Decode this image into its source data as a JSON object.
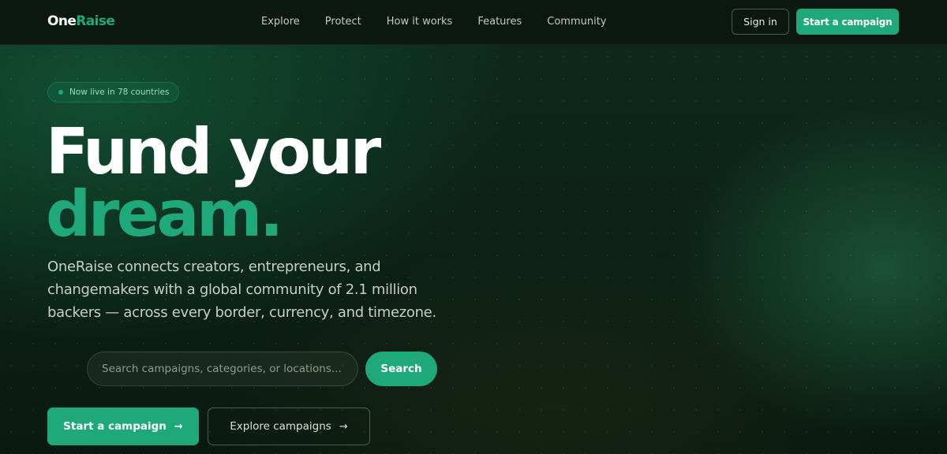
{
  "brand": {
    "name_part1": "One",
    "name_part2": "Raise",
    "accent_color": "#1fa97a"
  },
  "nav": {
    "items": [
      "Explore",
      "Protect",
      "How it works",
      "Features",
      "Community"
    ],
    "sign_in": "Sign in",
    "start_campaign": "Start a campaign"
  },
  "hero": {
    "badge": "Now live in 78 countries",
    "headline_line1": "Fund your",
    "headline_line2": "dream.",
    "description": "OneRaise connects creators, entrepreneurs, and changemakers with a global community of 2.1 million backers — across every border, currency, and timezone."
  },
  "search": {
    "placeholder": "Search campaigns, categories, or locations...",
    "button": "Search"
  },
  "cta": {
    "primary": "Start a campaign",
    "secondary": "Explore campaigns",
    "arrow_icon": "arrow-right-icon"
  }
}
